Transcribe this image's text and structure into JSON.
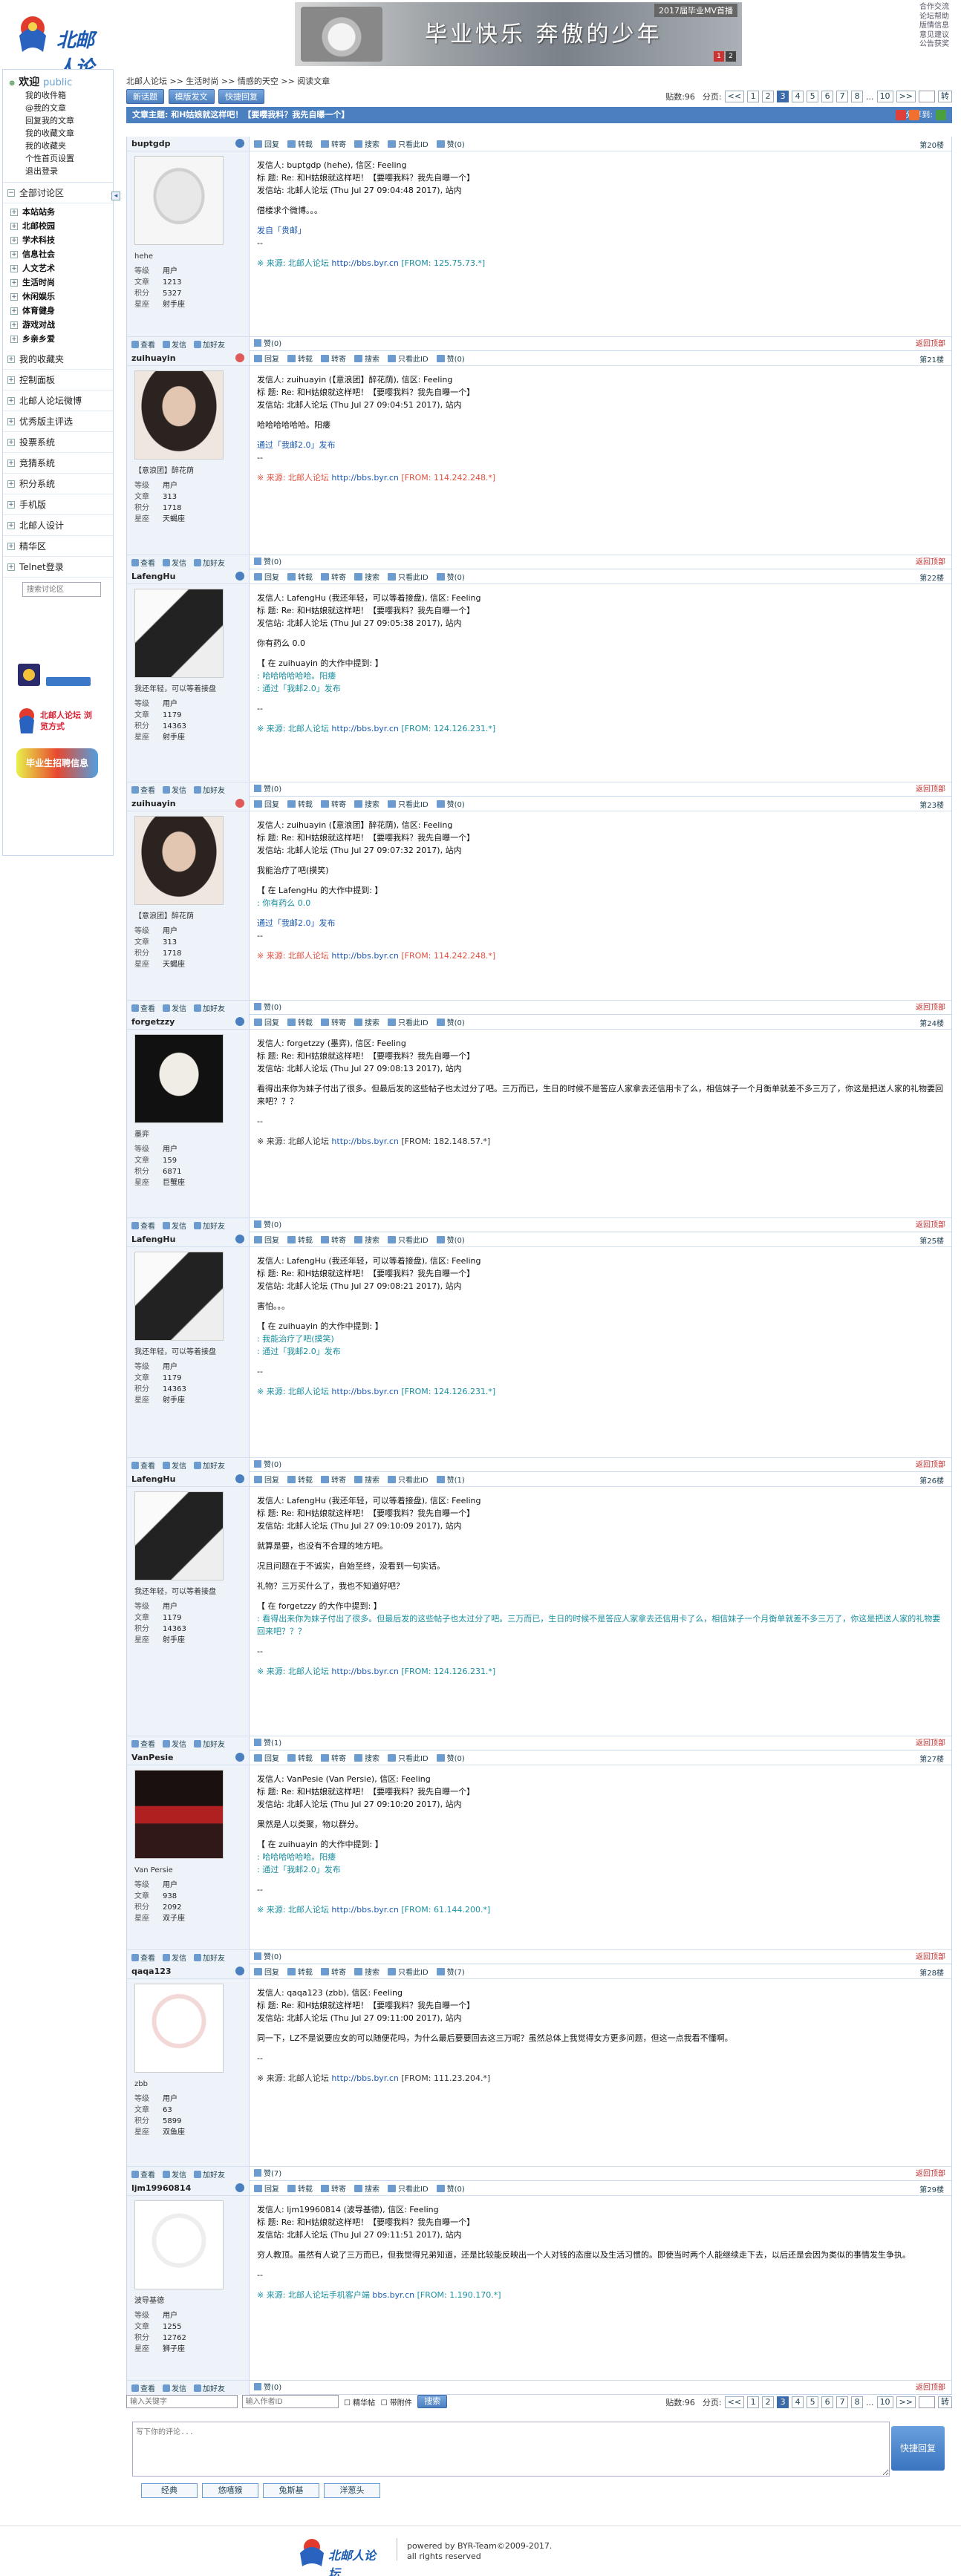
{
  "header": {
    "site_name": "北邮人论坛",
    "banner_tag": "2017届毕业MV首播",
    "banner_text": "毕业快乐 奔傲的少年",
    "top_links": [
      "合作交流",
      "论坛帮助",
      "版情信息",
      "意见建议",
      "公告获奖"
    ]
  },
  "sidebar": {
    "welcome": "欢迎",
    "username": "public",
    "user_links": [
      "我的收件箱",
      "@我的文章",
      "回复我的文章",
      "我的收藏文章",
      "我的收藏夹",
      "个性首页设置",
      "退出登录"
    ],
    "all_boards": "全部讨论区",
    "boards": [
      "本站站务",
      "北邮校园",
      "学术科技",
      "信息社会",
      "人文艺术",
      "生活时尚",
      "休闲娱乐",
      "体育健身",
      "游戏对战",
      "乡亲乡爱"
    ],
    "sections": [
      "我的收藏夹",
      "控制面板",
      "北邮人论坛微博",
      "优秀版主评选",
      "投票系统",
      "竞猜系统",
      "积分系统",
      "手机版",
      "北邮人设计",
      "精华区",
      "Telnet登录"
    ],
    "search_placeholder": "搜索讨论区",
    "ad1": "北邮人论坛 关注我",
    "ad2": "北邮人论坛 浏览方式",
    "ad3": "毕业生招聘信息"
  },
  "main": {
    "breadcrumb": "北邮人论坛 >> 生活时尚 >> 情感的天空 >> 阅读文章",
    "buttons": [
      "新话题",
      "模版发文",
      "快捷回复"
    ],
    "post_count_label": "贴数:96",
    "pages_label": "分页:",
    "pages": [
      "<<",
      "1",
      "2",
      "3",
      "4",
      "5",
      "6",
      "7",
      "8",
      "...",
      "10",
      ">>"
    ],
    "current_page": "3",
    "go": "转",
    "topic_title": "文章主题: 和H姑娘就这样吧！【要嘤我料？我先自曝一个】",
    "share_label": "分享到:",
    "actions": [
      "回复",
      "转载",
      "转寄",
      "搜索",
      "只看此ID",
      "赞"
    ],
    "tail_actions": [
      "查看",
      "发信",
      "加好友"
    ],
    "back_top": "返回顶部",
    "stat_labels": [
      "等级",
      "文章",
      "积分",
      "星座"
    ]
  },
  "posts": [
    {
      "user": "buptgdp",
      "floor": "第20楼",
      "nick": "hehe",
      "level": "用户",
      "articles": "1213",
      "score": "5327",
      "star": "射手座",
      "likes": "赞(0)",
      "tail_likes": "赞(0)",
      "lines": [
        "发信人: buptgdp (hehe), 信区: Feeling",
        "标 题: Re: 和H姑娘就这样吧！【要嘤我料？我先自曝一个】",
        "发信站: 北邮人论坛 (Thu Jul 27 09:04:48 2017), 站内"
      ],
      "body": [
        "借楼求个微博。。。"
      ],
      "sign": "发自「贵邮」",
      "src": "※ 来源: 北邮人论坛",
      "src_link": "http://bbs.byr.cn",
      "src_ip": "[FROM: 125.75.73.*]"
    },
    {
      "user": "zuihuayin",
      "floor": "第21楼",
      "nick": "【意浪团】醉花荫",
      "level": "用户",
      "articles": "313",
      "score": "1718",
      "star": "天蝎座",
      "likes": "赞(0)",
      "tail_likes": "赞(0)",
      "lines": [
        "发信人: zuihuayin (【意浪团】醉花荫), 信区: Feeling",
        "标 题: Re: 和H姑娘就这样吧！【要嘤我料？我先自曝一个】",
        "发信站: 北邮人论坛 (Thu Jul 27 09:04:51 2017), 站内"
      ],
      "body": [
        "哈哈哈哈哈哈。阳痿"
      ],
      "sign": "通过「我邮2.0」发布",
      "src": "※ 来源: 北邮人论坛",
      "src_link": "http://bbs.byr.cn",
      "src_ip": "[FROM: 114.242.248.*]"
    },
    {
      "user": "LafengHu",
      "floor": "第22楼",
      "nick": "我还年轻，可以等着接盘",
      "level": "用户",
      "articles": "1179",
      "score": "14363",
      "star": "射手座",
      "likes": "赞(0)",
      "tail_likes": "赞(0)",
      "lines": [
        "发信人: LafengHu (我还年轻，可以等着接盘), 信区: Feeling",
        "标 题: Re: 和H姑娘就这样吧！【要嘤我料？我先自曝一个】",
        "发信站: 北邮人论坛 (Thu Jul 27 09:05:38 2017), 站内"
      ],
      "body": [
        "你有药么 0.0"
      ],
      "quote_head": "【 在 zuihuayin 的大作中提到: 】",
      "quote": [
        ": 哈哈哈哈哈哈。阳痿",
        ": 通过「我邮2.0」发布"
      ],
      "src": "※ 来源: 北邮人论坛",
      "src_link": "http://bbs.byr.cn",
      "src_ip": "[FROM: 124.126.231.*]"
    },
    {
      "user": "zuihuayin",
      "floor": "第23楼",
      "nick": "【意浪团】醉花荫",
      "level": "用户",
      "articles": "313",
      "score": "1718",
      "star": "天蝎座",
      "likes": "赞(0)",
      "tail_likes": "赞(0)",
      "lines": [
        "发信人: zuihuayin (【意浪团】醉花荫), 信区: Feeling",
        "标 题: Re: 和H姑娘就这样吧！【要嘤我料？我先自曝一个】",
        "发信站: 北邮人论坛 (Thu Jul 27 09:07:32 2017), 站内"
      ],
      "body": [
        "我能治疗了吧(摸笑)"
      ],
      "quote_head": "【 在 LafengHu 的大作中提到: 】",
      "quote": [
        ": 你有药么 0.0"
      ],
      "sign": "通过「我邮2.0」发布",
      "src": "※ 来源: 北邮人论坛",
      "src_link": "http://bbs.byr.cn",
      "src_ip": "[FROM: 114.242.248.*]"
    },
    {
      "user": "forgetzzy",
      "floor": "第24楼",
      "nick": "墨弈",
      "level": "用户",
      "articles": "159",
      "score": "6871",
      "star": "巨蟹座",
      "likes": "赞(0)",
      "tail_likes": "赞(0)",
      "lines": [
        "发信人: forgetzzy (墨弈), 信区: Feeling",
        "标 题: Re: 和H姑娘就这样吧！【要嘤我料？我先自曝一个】",
        "发信站: 北邮人论坛 (Thu Jul 27 09:08:13 2017), 站内"
      ],
      "body": [
        "看得出来你为妹子付出了很多。但最后发的这些帖子也太过分了吧。三万而已，生日的时候不是答应人家拿去还信用卡了么，相信妹子一个月衡单就差不多三万了，你这是把送人家的礼物要回来吧？？？"
      ],
      "src": "※ 来源: 北邮人论坛",
      "src_link": "http://bbs.byr.cn",
      "src_ip": "[FROM: 182.148.57.*]"
    },
    {
      "user": "LafengHu",
      "floor": "第25楼",
      "nick": "我还年轻，可以等着接盘",
      "level": "用户",
      "articles": "1179",
      "score": "14363",
      "star": "射手座",
      "likes": "赞(0)",
      "tail_likes": "赞(0)",
      "lines": [
        "发信人: LafengHu (我还年轻，可以等着接盘), 信区: Feeling",
        "标 题: Re: 和H姑娘就这样吧！【要嘤我料？我先自曝一个】",
        "发信站: 北邮人论坛 (Thu Jul 27 09:08:21 2017), 站内"
      ],
      "body": [
        "害怕。。。"
      ],
      "quote_head": "【 在 zuihuayin 的大作中提到: 】",
      "quote": [
        ": 我能治疗了吧(摸笑)",
        ": 通过「我邮2.0」发布"
      ],
      "src": "※ 来源: 北邮人论坛",
      "src_link": "http://bbs.byr.cn",
      "src_ip": "[FROM: 124.126.231.*]"
    },
    {
      "user": "LafengHu",
      "floor": "第26楼",
      "nick": "我还年轻，可以等着接盘",
      "level": "用户",
      "articles": "1179",
      "score": "14363",
      "star": "射手座",
      "likes": "赞(1)",
      "tail_likes": "赞(1)",
      "lines": [
        "发信人: LafengHu (我还年轻，可以等着接盘), 信区: Feeling",
        "标 题: Re: 和H姑娘就这样吧！【要嘤我料？我先自曝一个】",
        "发信站: 北邮人论坛 (Thu Jul 27 09:10:09 2017), 站内"
      ],
      "body": [
        "就算是要，也没有不合理的地方吧。",
        "况且问题在于不诚实，自始至终，没看到一句实话。",
        "礼物？三万买什么了，我也不知道好吧？"
      ],
      "quote_head": "【 在 forgetzzy 的大作中提到: 】",
      "quote": [
        ": 看得出来你为妹子付出了很多。但最后发的这些帖子也太过分了吧。三万而已，生日的时候不是答应人家拿去还信用卡了么，相信妹子一个月衡单就差不多三万了，你这是把送人家的礼物要回来吧？？？"
      ],
      "src": "※ 来源: 北邮人论坛",
      "src_link": "http://bbs.byr.cn",
      "src_ip": "[FROM: 124.126.231.*]"
    },
    {
      "user": "VanPesie",
      "floor": "第27楼",
      "nick": "Van Persie",
      "level": "用户",
      "articles": "938",
      "score": "2092",
      "star": "双子座",
      "likes": "赞(0)",
      "tail_likes": "赞(0)",
      "lines": [
        "发信人: VanPesie (Van Persie), 信区: Feeling",
        "标 题: Re: 和H姑娘就这样吧！【要嘤我料？我先自曝一个】",
        "发信站: 北邮人论坛 (Thu Jul 27 09:10:20 2017), 站内"
      ],
      "body": [
        "果然是人以类聚，物以群分。"
      ],
      "quote_head": "【 在 zuihuayin 的大作中提到: 】",
      "quote": [
        ": 哈哈哈哈哈哈。阳痿",
        ": 通过「我邮2.0」发布"
      ],
      "src": "※ 来源: 北邮人论坛",
      "src_link": "http://bbs.byr.cn",
      "src_ip": "[FROM: 61.144.200.*]"
    },
    {
      "user": "qaqa123",
      "floor": "第28楼",
      "nick": "zbb",
      "level": "用户",
      "articles": "63",
      "score": "5899",
      "star": "双鱼座",
      "likes": "赞(7)",
      "tail_likes": "赞(7)",
      "lines": [
        "发信人: qaqa123 (zbb), 信区: Feeling",
        "标 题: Re: 和H姑娘就这样吧！【要嘤我料？我先自曝一个】",
        "发信站: 北邮人论坛 (Thu Jul 27 09:11:00 2017), 站内"
      ],
      "body": [
        "同一下，LZ不是说要应女的可以随便花吗，为什么最后要要回去这三万呢？虽然总体上我觉得女方更多问题，但这一点我看不懂啊。"
      ],
      "src": "※ 来源: 北邮人论坛",
      "src_link": "http://bbs.byr.cn",
      "src_ip": "[FROM: 111.23.204.*]"
    },
    {
      "user": "ljm19960814",
      "floor": "第29楼",
      "nick": "波导基德",
      "level": "用户",
      "articles": "1255",
      "score": "12762",
      "star": "狮子座",
      "likes": "赞(0)",
      "tail_likes": "赞(0)",
      "lines": [
        "发信人: ljm19960814 (波导基德), 信区: Feeling",
        "标 题: Re: 和H姑娘就这样吧！【要嘤我料？我先自曝一个】",
        "发信站: 北邮人论坛 (Thu Jul 27 09:11:51 2017), 站内"
      ],
      "body": [
        "穷人教顶。虽然有人说了三万而已，但我觉得兄弟知道，还是比较能反映出一个人对钱的态度以及生活习惯的。即使当时两个人能继续走下去，以后还是会因为类似的事情发生争执。"
      ],
      "src": "※ 来源: 北邮人论坛手机客户端",
      "src_link": "bbs.byr.cn",
      "src_ip": "[FROM: 1.190.170.*]"
    }
  ],
  "bottom": {
    "search_author_ph": "输入关键字",
    "search_id_ph": "输入作者ID",
    "check1": "精华帖",
    "check2": "带附件",
    "search_btn": "搜索",
    "quick_placeholder": "写下你的评论...",
    "quick_btn": "快捷回复",
    "emotabs": [
      "经典",
      "悠嘻猴",
      "兔斯基",
      "洋葱头"
    ]
  },
  "footer": {
    "powered": "powered by BYR-Team©2009-2017.",
    "rights": "all rights reserved",
    "logo": "北邮人论坛"
  },
  "colors": {
    "accent": "#4a7fc0",
    "panel": "#eef3fa",
    "link": "#1c5bb3",
    "quote": "#1a8fa0",
    "red": "#c03030"
  }
}
